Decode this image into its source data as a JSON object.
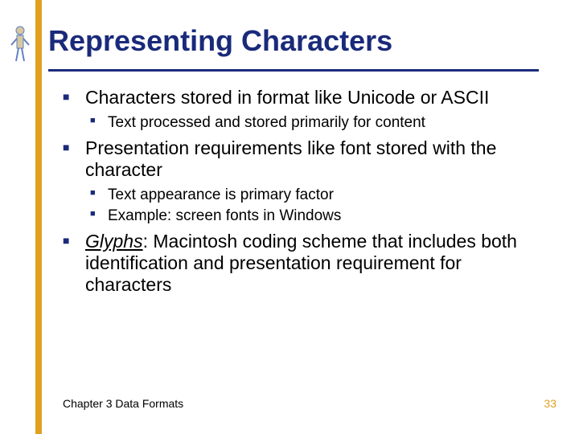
{
  "title": "Representing Characters",
  "bullets": [
    {
      "text": "Characters stored in format like Unicode or ASCII",
      "children": [
        "Text processed and stored primarily for content"
      ]
    },
    {
      "text": "Presentation requirements like font stored with the character",
      "children": [
        "Text appearance is primary factor",
        "Example: screen fonts in Windows"
      ]
    },
    {
      "glyphs": "Glyphs",
      "rest": ":  Macintosh coding scheme that includes both identification and presentation requirement for characters",
      "children": []
    }
  ],
  "footer": {
    "left": "Chapter 3 Data Formats",
    "right": "33"
  }
}
